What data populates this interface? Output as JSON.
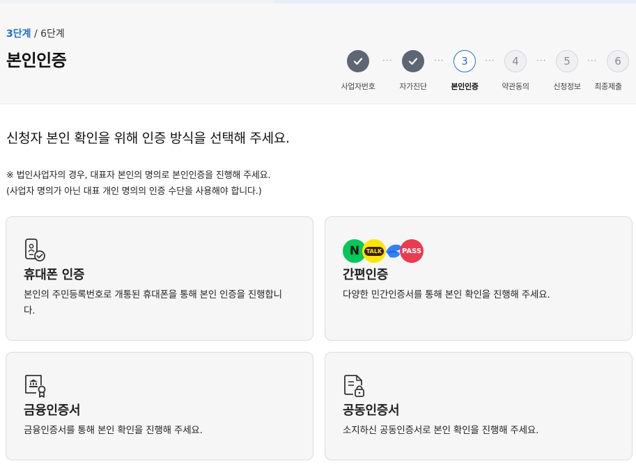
{
  "header": {
    "current_step": "3단계",
    "step_separator": " / ",
    "total_steps": "6단계",
    "title": "본인인증"
  },
  "stepper": {
    "steps": [
      {
        "number": "",
        "label": "사업자번호",
        "state": "done"
      },
      {
        "number": "",
        "label": "자가진단",
        "state": "done"
      },
      {
        "number": "3",
        "label": "본인인증",
        "state": "active"
      },
      {
        "number": "4",
        "label": "약관동의",
        "state": "todo"
      },
      {
        "number": "5",
        "label": "신청정보",
        "state": "todo"
      },
      {
        "number": "6",
        "label": "최종제출",
        "state": "todo"
      }
    ],
    "dots": "···"
  },
  "main": {
    "heading": "신청자 본인 확인을 위해 인증 방식을 선택해 주세요.",
    "notice_line1": "※ 법인사업자의 경우, 대표자 본인의 명의로 본인인증을 진행해 주세요.",
    "notice_line2": "(사업자 명의가 아닌 대표 개인 명의의 인증 수단을 사용해야 합니다.)"
  },
  "cards": {
    "phone": {
      "title": "휴대폰 인증",
      "desc": "본인의 주민등록번호로 개통된 휴대폰을 통해 본인 인증을 진행합니다.",
      "icon": "phone-check-icon"
    },
    "simple": {
      "title": "간편인증",
      "desc": "다양한 민간인증서를 통해 본인 확인을 진행해 주세요.",
      "badges": {
        "naver": "N",
        "kakao": "TALK",
        "pass": "PASS"
      }
    },
    "finance": {
      "title": "금융인증서",
      "desc": "금융인증서를 통해 본인 확인을 진행해 주세요.",
      "icon": "bank-certificate-icon"
    },
    "joint": {
      "title": "공동인증서",
      "desc": "소지하신 공동인증서로 본인 확인을 진행해 주세요.",
      "icon": "document-lock-icon"
    }
  },
  "colors": {
    "accent": "#1f6fd1",
    "done_step": "#5e6673",
    "naver": "#03c75a",
    "kakao": "#fee500",
    "toss": "#3182f6",
    "pass": "#ea3c4f"
  }
}
